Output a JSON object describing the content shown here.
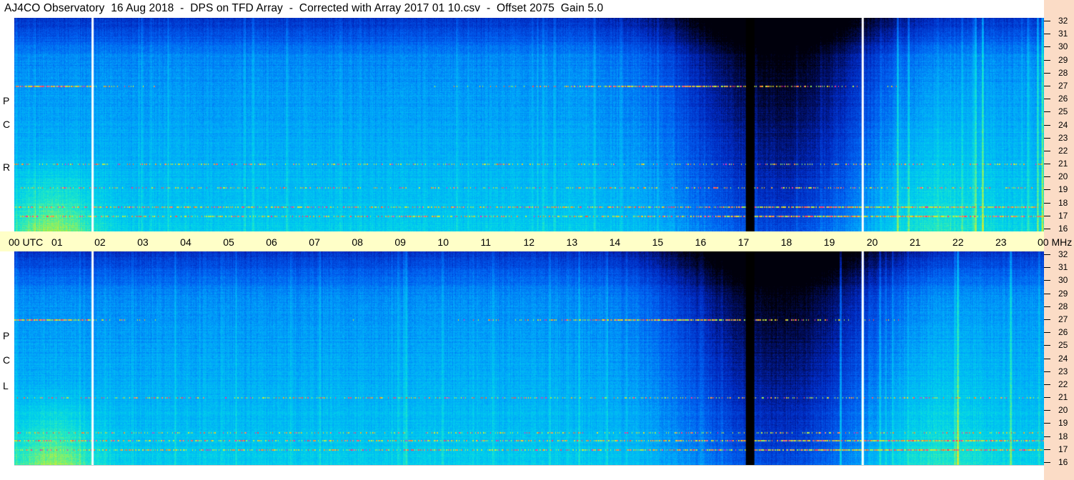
{
  "title": "AJ4CO Observatory  16 Aug 2018  -  DPS on TFD Array  -  Corrected with Array 2017 01 10.csv  -  Offset 2075  Gain 5.0",
  "chart_data": [
    {
      "type": "heatmap",
      "name": "RCP",
      "polarization_label": [
        "R",
        "C",
        "P"
      ],
      "y_ticks": [
        16,
        17,
        18,
        19,
        20,
        21,
        22,
        23,
        24,
        25,
        26,
        27,
        28,
        29,
        30,
        31,
        32
      ],
      "ylim": [
        16,
        32
      ],
      "xlim_utc_hours": [
        0,
        24
      ]
    },
    {
      "type": "heatmap",
      "name": "LCP",
      "polarization_label": [
        "L",
        "C",
        "P"
      ],
      "y_ticks": [
        16,
        17,
        18,
        19,
        20,
        21,
        22,
        23,
        24,
        25,
        26,
        27,
        28,
        29,
        30,
        31,
        32
      ],
      "ylim": [
        16,
        32
      ],
      "xlim_utc_hours": [
        0,
        24
      ]
    }
  ],
  "time_axis": {
    "labels": [
      "00 UTC",
      "01",
      "02",
      "03",
      "04",
      "05",
      "06",
      "07",
      "08",
      "09",
      "10",
      "11",
      "12",
      "13",
      "14",
      "15",
      "16",
      "17",
      "18",
      "19",
      "20",
      "21",
      "22",
      "23",
      "00 MHz"
    ],
    "hours": [
      0,
      1,
      2,
      3,
      4,
      5,
      6,
      7,
      8,
      9,
      10,
      11,
      12,
      13,
      14,
      15,
      16,
      17,
      18,
      19,
      20,
      21,
      22,
      23,
      24
    ]
  },
  "colors": {
    "right_pad": "#fbdcc6",
    "time_strip": "#ffffc8",
    "gap_bar": "#000000",
    "marker_line": "#ffffff"
  },
  "gap_utc_hours": [
    17.05,
    17.25
  ],
  "white_marker_utc_hours": [
    1.8,
    19.75
  ]
}
